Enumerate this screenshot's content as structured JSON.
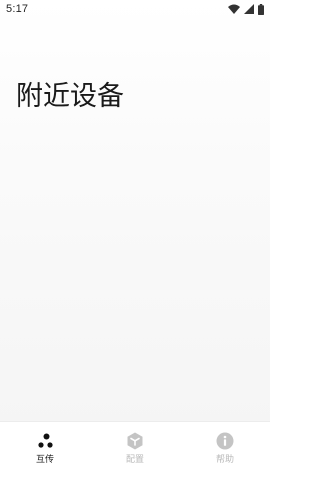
{
  "status_bar": {
    "time": "5:17",
    "icons": [
      "wifi-icon",
      "signal-icon",
      "battery-icon"
    ]
  },
  "page": {
    "title": "附近设备"
  },
  "bottom_nav": {
    "items": [
      {
        "label": "互传",
        "icon": "transfer-dots-icon",
        "active": true
      },
      {
        "label": "配置",
        "icon": "config-cube-icon",
        "active": false
      },
      {
        "label": "帮助",
        "icon": "info-icon",
        "active": false
      }
    ]
  },
  "colors": {
    "active": "#1a1a1a",
    "inactive": "#c4c4c4",
    "background": "#f7f7f7"
  }
}
